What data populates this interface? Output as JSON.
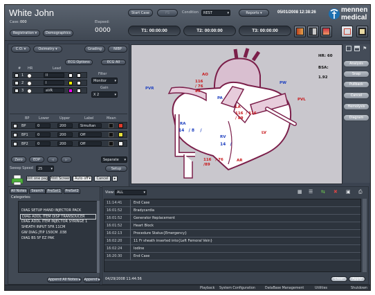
{
  "header": {
    "patient_name": "White John",
    "case_label": "Case:",
    "case_value": "000",
    "elapsed_label": "Elapsed:",
    "elapsed_value": "0000",
    "registration": "Registration",
    "demographics": "Demographics",
    "start_case": "Start Case",
    "fs": "FS",
    "condition_label": "Condition",
    "condition_value": "REST",
    "reports": "Reports",
    "datetime": "05/01/2008 12:38:26",
    "brand_top": "mennen",
    "brand_bottom": "medical",
    "t1": "T1: 00:00:00",
    "t2": "T2: 00:00:00",
    "t3": "T3: 00:00:00"
  },
  "left_panel": {
    "co": "C.O.",
    "oximetry": "Oximetry",
    "grading": "Grading",
    "nibp": "NIBP",
    "ecg_options": "ECG Options",
    "ecg_all": "ECG All",
    "col_hr": "HR",
    "col_lead": "Lead",
    "ecg_rows": [
      {
        "num": "1",
        "lead": "II",
        "color": "#ffffff"
      },
      {
        "num": "2",
        "lead": "I",
        "color": "#ffff00"
      },
      {
        "num": "3",
        "lead": "aVR",
        "color": "#ff00ff"
      }
    ],
    "filter_label": "Filter",
    "filter_value": "Monitor",
    "gain_label": "Gain",
    "gain_value": "X 2",
    "bp_headers": {
      "bp": "BP",
      "lower": "Lower",
      "upper": "Upper",
      "label": "Label",
      "mean": "Mean"
    },
    "bp_rows": [
      {
        "name": "BP",
        "lower": "0",
        "upper": "200",
        "label": "Simultan"
      },
      {
        "name": "BP1",
        "lower": "0",
        "upper": "200",
        "label": "Off"
      },
      {
        "name": "BP2",
        "lower": "0",
        "upper": "200",
        "label": "Off"
      }
    ],
    "zero": "Zero",
    "edp": "EDP",
    "separate": "Separate",
    "sweep_label": "Sweep Speed",
    "sweep_value": "25",
    "setup": "Setup",
    "print_one_page": "Print one page",
    "print_screen": "Print Screen",
    "auto_off": "Auto off",
    "cancel": "Cancel"
  },
  "diagram": {
    "labels": {
      "ao": "AO",
      "ao_vals": "116\n/ 76\n89",
      "pvr": "PVR",
      "pa": "PA",
      "pw": "PW",
      "pvl": "PVL",
      "ra": "RA",
      "ra_vals": "14   / 8    /",
      "la": "LA",
      "la_vals": "116  / 116\n/ 89",
      "lv": "LV",
      "rv": "RV",
      "rv_vals": "14   /",
      "ar": "AR",
      "ar_vals": "116   / 76\n/89"
    },
    "hr_label": "HR: 60",
    "bsa_label": "BSA:",
    "bsa_value": "1.92"
  },
  "right_buttons": [
    "Analysis",
    "Snap",
    "Pullback",
    "Cancel",
    "Hemolysis",
    "Diagram"
  ],
  "notes": {
    "tabs": [
      "All Notes",
      "Search",
      "PreSet1",
      "PreSet2"
    ],
    "categories_label": "Categories:",
    "categories": [
      "DIAG SETUP HAND INJECTOR PACK",
      "DIAG ADDL ITEM DISP TRANSDUCER",
      "DIAG ADDL ITEM INJECTOR SYRINGE 1",
      "SHEATH INPUT 5FR 11CM",
      "GW DIAG JTIP 150CM .038",
      "DIAG BS 5F EZ PAK"
    ],
    "append_all": "Append All Notes",
    "append": "Append",
    "view_label": "View:",
    "view_value": "ALL",
    "events": [
      {
        "time": "11:14:41",
        "desc": "End Case"
      },
      {
        "time": "16:01:52",
        "desc": "Bradycardia"
      },
      {
        "time": "16:01:52",
        "desc": "Generator Replacement"
      },
      {
        "time": "16:01:52",
        "desc": "Heart Block"
      },
      {
        "time": "16:02:13",
        "desc": "Procedure Status{Emergency}"
      },
      {
        "time": "16:02:20",
        "desc": "11 Fr sheath inserted into{Left Femoral Vein}"
      },
      {
        "time": "16:02:24",
        "desc": "Iodine"
      },
      {
        "time": "16:20:30",
        "desc": "End Case"
      }
    ],
    "footer_time": "04/29/2008 11:44:56",
    "clear": "Clear",
    "apply": "Apply"
  },
  "status_bar": {
    "playback": "Playback",
    "system_configuration": "System Configuration",
    "database_management": "DataBase Management",
    "utilities": "Utilities",
    "shutdown": "Shutdown"
  }
}
